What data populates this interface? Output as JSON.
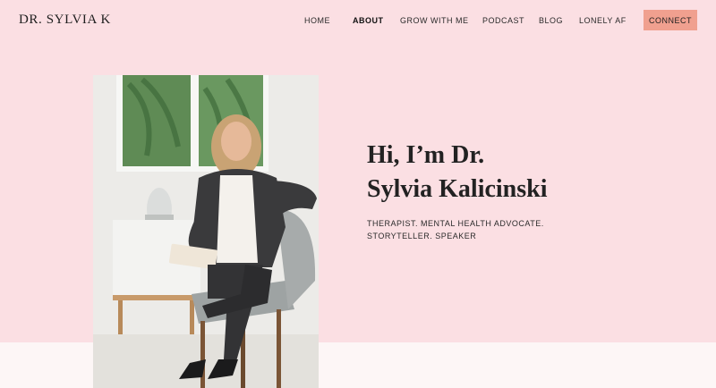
{
  "header": {
    "logo": "DR. SYLVIA K",
    "nav": [
      {
        "label": "HOME",
        "active": false
      },
      {
        "label": "ABOUT",
        "active": true
      },
      {
        "label": "GROW WITH ME",
        "active": false
      },
      {
        "label": "PODCAST",
        "active": false
      },
      {
        "label": "BLOG",
        "active": false
      },
      {
        "label": "LONELY AF",
        "active": false
      }
    ],
    "connect_label": "CONNECT"
  },
  "hero": {
    "title_line1": "Hi, I’m Dr.",
    "title_line2": "Sylvia Kalicinski",
    "subtitle_line1": "THERAPIST. MENTAL HEALTH ADVOCATE.",
    "subtitle_line2": "STORYTELLER. SPEAKER"
  },
  "colors": {
    "page_background": "#fbdfe3",
    "bottom_band": "#fdf6f6",
    "connect_button": "#f0a08f",
    "text": "#1f1f1f"
  }
}
